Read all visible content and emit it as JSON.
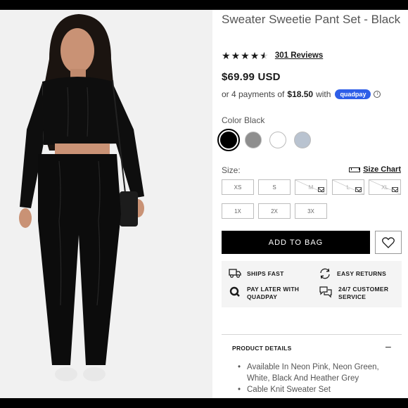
{
  "product": {
    "title": "Sweater Sweetie Pant Set - Black",
    "rating": 4.5,
    "reviews_label": "301 Reviews",
    "price": "$69.99 USD",
    "installment_prefix": "or 4 payments of",
    "installment_amount": "$18.50",
    "installment_suffix": "with",
    "pay_brand": "quadpay"
  },
  "color": {
    "label": "Color Black",
    "swatches": [
      {
        "name": "Black",
        "hex": "#000000",
        "selected": true
      },
      {
        "name": "Grey",
        "hex": "#8e8e8e",
        "selected": false
      },
      {
        "name": "White",
        "hex": "#ffffff",
        "selected": false
      },
      {
        "name": "Heather Grey",
        "hex": "#b9c3d0",
        "selected": false
      }
    ]
  },
  "size": {
    "label": "Size:",
    "chart_label": "Size Chart",
    "options": [
      {
        "label": "XS",
        "available": true
      },
      {
        "label": "S",
        "available": true
      },
      {
        "label": "M",
        "available": false
      },
      {
        "label": "L",
        "available": false
      },
      {
        "label": "XL",
        "available": false
      },
      {
        "label": "1X",
        "available": true
      },
      {
        "label": "2X",
        "available": true
      },
      {
        "label": "3X",
        "available": true
      }
    ]
  },
  "actions": {
    "add_to_bag": "ADD TO BAG",
    "wishlist_icon": "heart-icon"
  },
  "perks": {
    "ships_fast": "SHIPS FAST",
    "easy_returns": "EASY RETURNS",
    "pay_later_line1": "PAY LATER WITH",
    "pay_later_line2": "QUADPAY",
    "support_line1": "24/7 CUSTOMER",
    "support_line2": "SERVICE"
  },
  "details": {
    "heading": "PRODUCT DETAILS",
    "toggle": "–",
    "items": [
      "Available In Neon Pink, Neon Green, White, Black And Heather Grey",
      "Cable Knit Sweater Set"
    ]
  },
  "colors": {
    "accent": "#000000",
    "quadpay": "#2e5ee8",
    "panel_bg": "#f4f4f4"
  }
}
